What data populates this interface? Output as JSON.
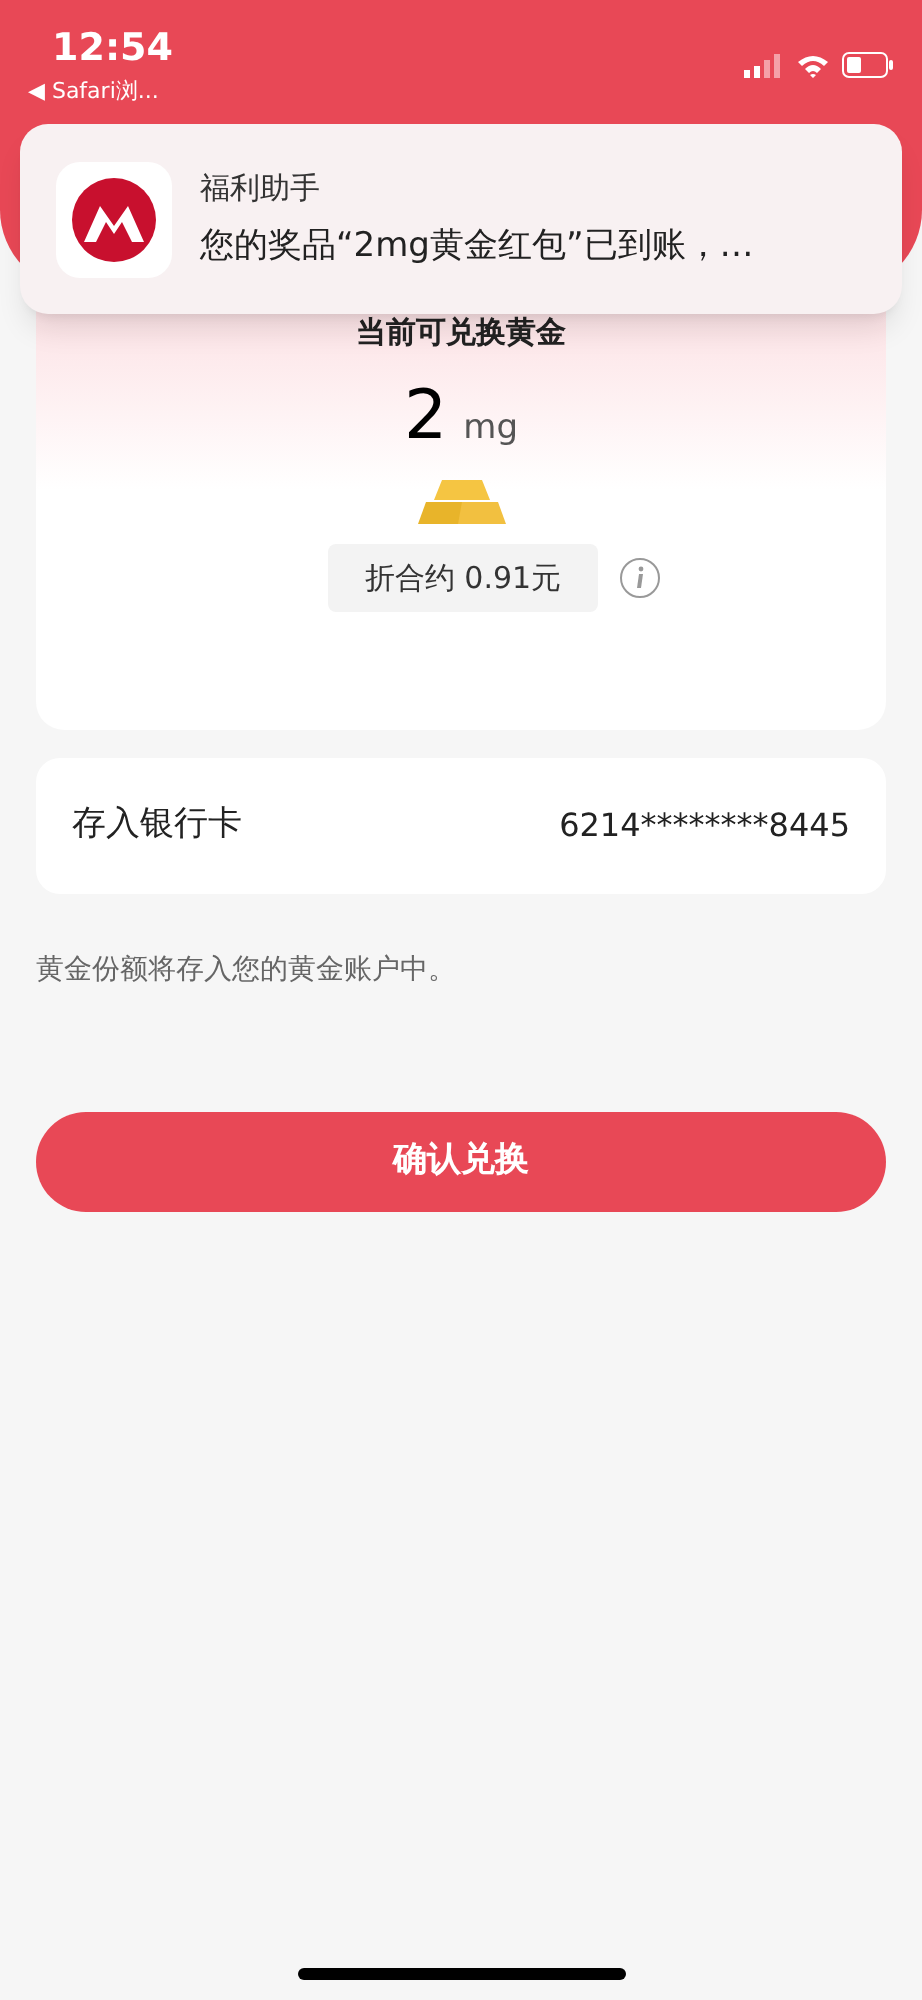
{
  "status_bar": {
    "time": "12:54",
    "back_app": "◀ Safari浏..."
  },
  "notification": {
    "app": "福利助手",
    "message": "您的奖品“2mg黄金红包”已到账，…"
  },
  "gold_card": {
    "heading": "当前可兑换黄金",
    "amount": "2",
    "unit": "mg",
    "equivalent": "折合约 0.91元"
  },
  "bank_row": {
    "label": "存入银行卡",
    "value": "6214********8445"
  },
  "note": "黄金份额将存入您的黄金账户中。",
  "confirm_button": "确认兑换"
}
